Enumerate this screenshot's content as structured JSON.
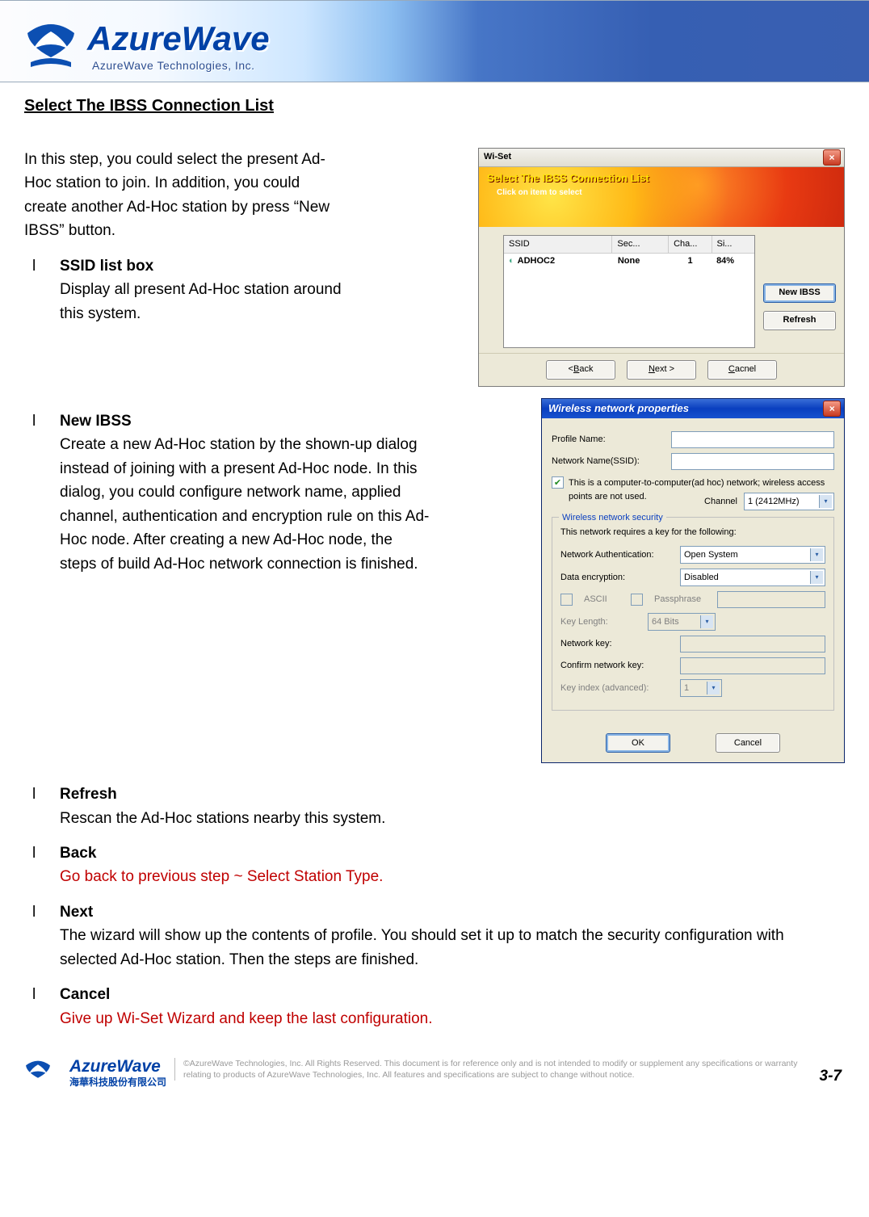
{
  "brand": {
    "name": "AzureWave",
    "tagline": "AzureWave  Technologies,  Inc.",
    "chinese": "海華科技股份有限公司"
  },
  "section_title": "Select The IBSS Connection List",
  "intro": "In this step, you could select the present Ad-Hoc station to join. In addition, you could create another Ad-Hoc station by press “New IBSS” button.",
  "items": [
    {
      "title": "SSID list box",
      "body": "Display all present Ad-Hoc station around this system.",
      "red": false,
      "width": "narrow"
    },
    {
      "title": "New IBSS",
      "body": "Create a new Ad-Hoc station by the shown-up dialog instead of joining with a present Ad-Hoc node. In this dialog, you could configure network name, applied channel, authentication and encryption rule on this Ad-Hoc node. After creating a new Ad-Hoc node, the steps of build Ad-Hoc network connection is finished.",
      "red": false,
      "width": "wide"
    },
    {
      "title": "Refresh",
      "body": "Rescan the Ad-Hoc stations nearby this system.",
      "red": false
    },
    {
      "title": "Back",
      "body": "Go back to previous step ~ Select Station Type.",
      "red": true
    },
    {
      "title": "Next",
      "body": "The wizard will show up the contents of profile. You should set it up to match the security configuration with selected Ad-Hoc station. Then the steps are finished.",
      "red": false
    },
    {
      "title": "Cancel",
      "body": "Give up Wi-Set Wizard and keep the last configuration.",
      "red": true
    }
  ],
  "wiset": {
    "title": "Wi-Set",
    "header_title": "Select The IBSS Connection List",
    "header_sub": "Click on item to select",
    "columns": [
      "SSID",
      "Sec...",
      "Cha...",
      "Si..."
    ],
    "rows": [
      {
        "ssid": "ADHOC2",
        "sec": "None",
        "cha": "1",
        "si": "84%"
      }
    ],
    "side_buttons": [
      "New IBSS",
      "Refresh"
    ],
    "footer_buttons": {
      "back": "< Back",
      "next": "Next >",
      "cancel": "Cacnel"
    }
  },
  "wnp": {
    "title": "Wireless network properties",
    "labels": {
      "profile": "Profile Name:",
      "ssid": "Network Name(SSID):",
      "adhoc": "This is a computer-to-computer(ad hoc) network; wireless access points are not used.",
      "channel_lbl": "Channel",
      "channel_val": "1 (2412MHz)",
      "legend": "Wireless network security",
      "sec_text": "This network requires a key for the following:",
      "auth": "Network Authentication:",
      "auth_val": "Open System",
      "enc": "Data encryption:",
      "enc_val": "Disabled",
      "ascii": "ASCII",
      "passphrase": "Passphrase",
      "keylen": "Key Length:",
      "keylen_val": "64 Bits",
      "netkey": "Network key:",
      "confkey": "Confirm network key:",
      "keyidx": "Key index (advanced):",
      "keyidx_val": "1",
      "ok": "OK",
      "cancel": "Cancel"
    }
  },
  "footer_text": "©AzureWave Technologies, Inc. All Rights Reserved. This document is for reference only and is not intended to modify or supplement any specifications or  warranty relating to products of AzureWave Technologies, Inc.  All features and specifications are subject to change without notice.",
  "page_number": "3-7"
}
